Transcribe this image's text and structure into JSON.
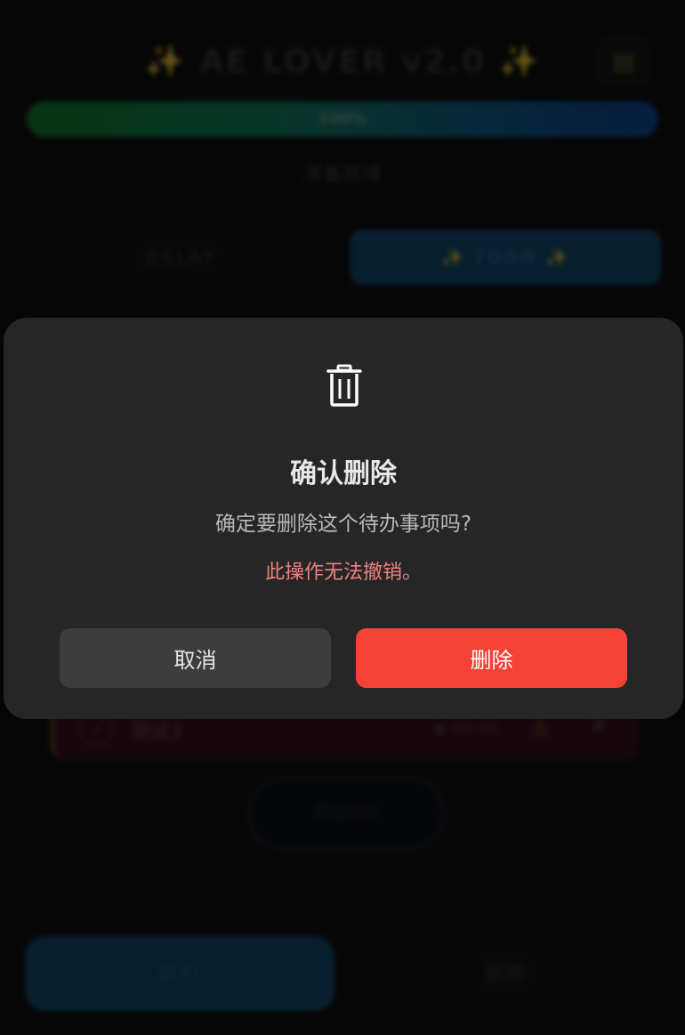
{
  "app": {
    "title_text": "AE LOVER v2.0",
    "sparkle": "✨",
    "settings_icon": "clipboard-icon",
    "progress": {
      "label": "100%",
      "value": 1.0
    },
    "status": "准备就绪",
    "tabs": [
      {
        "label": "DELAY"
      },
      {
        "label": "✨ TODO ✨"
      }
    ],
    "todo_item": {
      "text": "测试3",
      "time": "◉ 09:44",
      "warn": "⚠",
      "close": "✕"
    },
    "add_button": "添加行为",
    "execute_button": "执行",
    "refresh_button": "刷新"
  },
  "dialog": {
    "icon": "trash-icon",
    "title": "确认删除",
    "message": "确定要删除这个待办事项吗?",
    "warning": "此操作无法撤销。",
    "cancel_label": "取消",
    "delete_label": "删除"
  },
  "colors": {
    "dialog_bg": "#262626",
    "delete_btn": "#f44336",
    "cancel_btn": "#3d3d3d",
    "warning_text": "#f08080"
  }
}
